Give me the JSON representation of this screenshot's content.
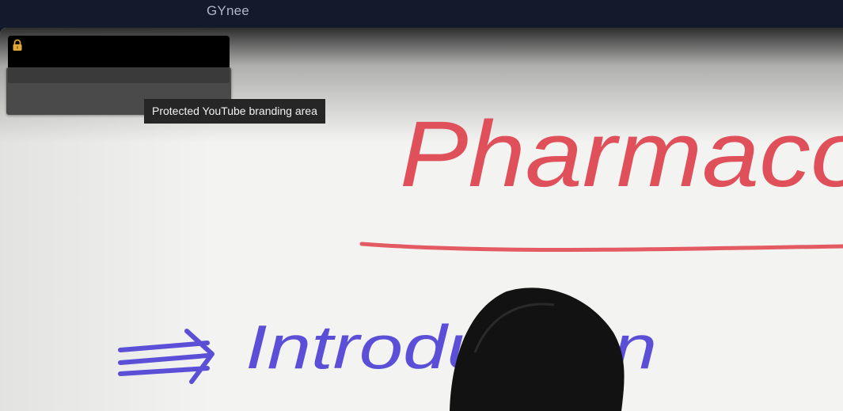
{
  "header": {
    "channel_name": "GYnee"
  },
  "player": {
    "board_heading": "Pharmacol",
    "board_subheading": "Introduction"
  },
  "branding": {
    "lock_icon": "lock-icon",
    "tooltip": "Protected YouTube branding area"
  },
  "colors": {
    "header_bg": "#121a2b",
    "board_red": "#e0505a",
    "board_blue": "#5a4fd6"
  }
}
